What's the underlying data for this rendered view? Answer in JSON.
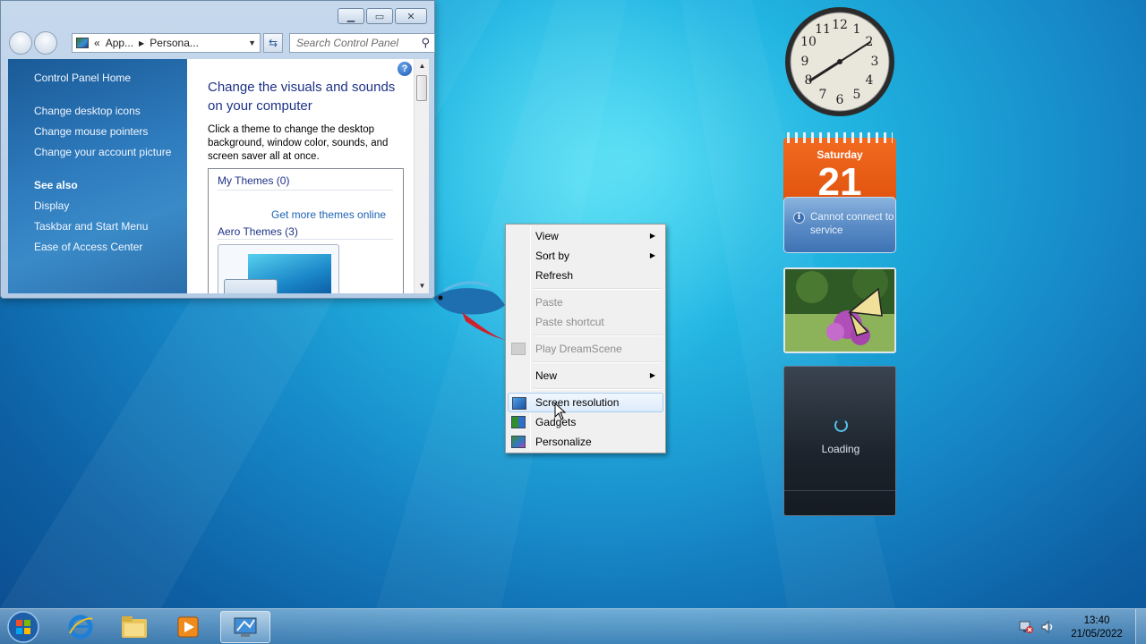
{
  "control_panel": {
    "address_parts": [
      "«",
      "App...",
      "Persona..."
    ],
    "search_placeholder": "Search Control Panel",
    "left_links": [
      "Control Panel Home",
      "Change desktop icons",
      "Change mouse pointers",
      "Change your account picture"
    ],
    "see_also_title": "See also",
    "see_also_links": [
      "Display",
      "Taskbar and Start Menu",
      "Ease of Access Center"
    ],
    "heading": "Change the visuals and sounds on your computer",
    "description": "Click a theme to change the desktop background, window color, sounds, and screen saver all at once.",
    "my_themes": "My Themes (0)",
    "get_more": "Get more themes online",
    "aero_themes": "Aero Themes (3)",
    "help_glyph": "?"
  },
  "context_menu": {
    "items": [
      {
        "label": "View",
        "submenu": true,
        "disabled": false
      },
      {
        "label": "Sort by",
        "submenu": true,
        "disabled": false
      },
      {
        "label": "Refresh",
        "submenu": false,
        "disabled": false
      },
      {
        "label": "Paste",
        "submenu": false,
        "disabled": true
      },
      {
        "label": "Paste shortcut",
        "submenu": false,
        "disabled": true
      },
      {
        "label": "Play DreamScene",
        "submenu": false,
        "disabled": true,
        "icon": "dreamscene-icon"
      },
      {
        "label": "New",
        "submenu": true,
        "disabled": false
      },
      {
        "label": "Screen resolution",
        "submenu": false,
        "disabled": false,
        "icon": "monitor-icon",
        "highlighted": true
      },
      {
        "label": "Gadgets",
        "submenu": false,
        "disabled": false,
        "icon": "gadgets-icon"
      },
      {
        "label": "Personalize",
        "submenu": false,
        "disabled": false,
        "icon": "personalize-icon"
      }
    ]
  },
  "gadgets": {
    "calendar_day": "Saturday",
    "calendar_date": "21",
    "calendar_message": "Cannot connect to service",
    "feed_status": "Loading"
  },
  "taskbar": {
    "time": "13:40",
    "date": "21/05/2022"
  },
  "colors": {
    "link_blue": "#1e62b5",
    "heading_blue": "#1e3287",
    "calendar_orange": "#f26a1f"
  }
}
